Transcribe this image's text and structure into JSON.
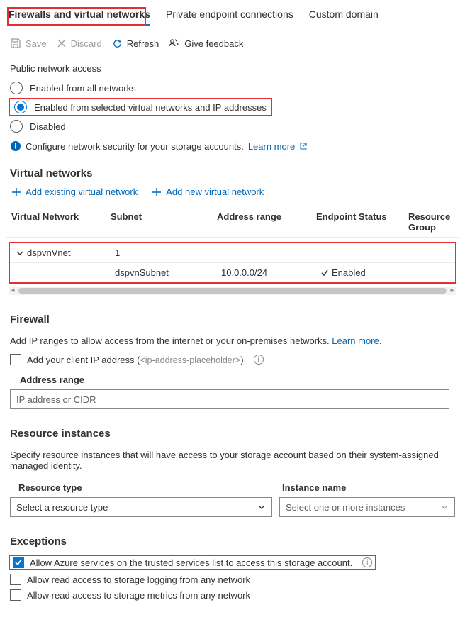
{
  "tabs": {
    "t1": "Firewalls and virtual networks",
    "t2": "Private endpoint connections",
    "t3": "Custom domain"
  },
  "toolbar": {
    "save": "Save",
    "discard": "Discard",
    "refresh": "Refresh",
    "feedback": "Give feedback"
  },
  "public_access": {
    "heading": "Public network access",
    "opt1": "Enabled from all networks",
    "opt2": "Enabled from selected virtual networks and IP addresses",
    "opt3": "Disabled",
    "info": "Configure network security for your storage accounts.",
    "learn": "Learn more"
  },
  "vnets": {
    "heading": "Virtual networks",
    "add_existing": "Add existing virtual network",
    "add_new": "Add new virtual network",
    "cols": {
      "vnet": "Virtual Network",
      "subnet": "Subnet",
      "addr": "Address range",
      "ep": "Endpoint Status",
      "rg": "Resource Group"
    },
    "row1": {
      "name": "dspvnVnet",
      "subnet_count": "1"
    },
    "row2": {
      "subnet": "dspvnSubnet",
      "addr": "10.0.0.0/24",
      "ep": "Enabled"
    }
  },
  "firewall": {
    "heading": "Firewall",
    "desc": "Add IP ranges to allow access from the internet or your on-premises networks.",
    "learn": "Learn more.",
    "client_ip_pre": "Add your client IP address (",
    "client_ip_placeholder": "<ip-address-placeholder>",
    "client_ip_post": ")",
    "range_label": "Address range",
    "range_placeholder": "IP address or CIDR"
  },
  "resinst": {
    "heading": "Resource instances",
    "desc": "Specify resource instances that will have access to your storage account based on their system-assigned managed identity.",
    "type_label": "Resource type",
    "name_label": "Instance name",
    "type_ph": "Select a resource type",
    "name_ph": "Select one or more instances"
  },
  "exceptions": {
    "heading": "Exceptions",
    "opt1": "Allow Azure services on the trusted services list to access this storage account.",
    "opt2": "Allow read access to storage logging from any network",
    "opt3": "Allow read access to storage metrics from any network"
  }
}
